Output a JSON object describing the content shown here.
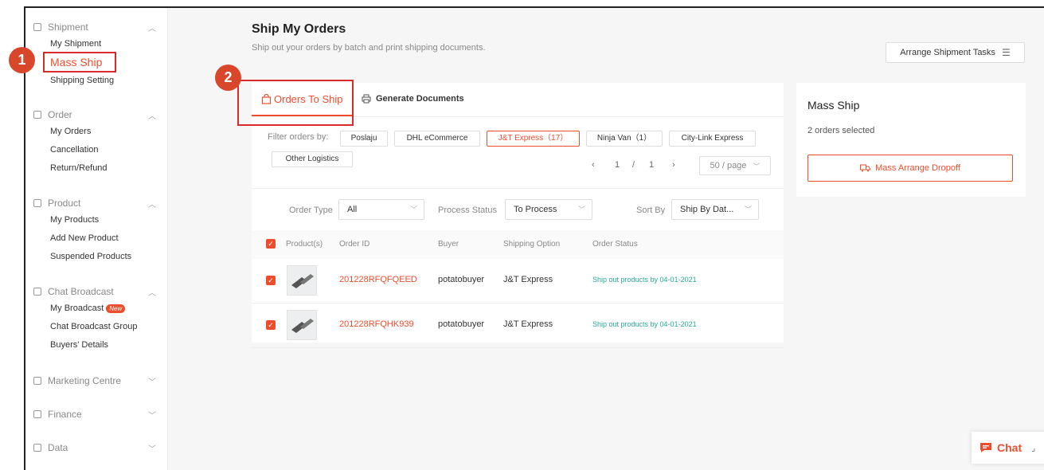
{
  "sidebar": {
    "groups": [
      {
        "title": "Shipment",
        "items": [
          "My Shipment",
          "Mass Ship",
          "Shipping Setting"
        ]
      },
      {
        "title": "Order",
        "items": [
          "My Orders",
          "Cancellation",
          "Return/Refund"
        ]
      },
      {
        "title": "Product",
        "items": [
          "My Products",
          "Add New Product",
          "Suspended Products"
        ]
      },
      {
        "title": "Chat Broadcast",
        "items": [
          "My Broadcast",
          "Chat Broadcast Group",
          "Buyers' Details"
        ],
        "new_badge": "New"
      },
      {
        "title": "Marketing Centre"
      },
      {
        "title": "Finance"
      },
      {
        "title": "Data"
      }
    ]
  },
  "callouts": [
    "1",
    "2"
  ],
  "page": {
    "title": "Ship My Orders",
    "subtitle": "Ship out your orders by batch and print shipping documents.",
    "arrange_button": "Arrange Shipment Tasks",
    "menu_icon": "☰"
  },
  "tabs": [
    "Orders To Ship",
    "Generate Documents"
  ],
  "filters": {
    "label": "Filter orders by:",
    "chips": [
      "Poslaju",
      "DHL eCommerce",
      "J&T Express（17）",
      "Ninja Van（1）",
      "City-Link Express",
      "Other Logistics"
    ],
    "active": "J&T Express（17）"
  },
  "pager": {
    "current": "1",
    "slash": "/",
    "total": "1",
    "per_page": "50 / page",
    "prev": "‹",
    "next": "›"
  },
  "order_filters": {
    "order_type_label": "Order Type",
    "order_type_value": "All",
    "process_status_label": "Process Status",
    "process_status_value": "To Process",
    "sort_by_label": "Sort By",
    "sort_by_value": "Ship By Dat..."
  },
  "table": {
    "columns": [
      "Product(s)",
      "Order ID",
      "Buyer",
      "Shipping Option",
      "Order Status"
    ],
    "rows": [
      {
        "order_id": "201228RFQFQEED",
        "buyer": "potatobuyer",
        "shipping": "J&T Express",
        "status": "Ship out products by 04-01-2021"
      },
      {
        "order_id": "201228RFQHK939",
        "buyer": "potatobuyer",
        "shipping": "J&T Express",
        "status": "Ship out products by 04-01-2021"
      }
    ]
  },
  "side_panel": {
    "title": "Mass Ship",
    "selected": "2 orders selected",
    "button": "Mass Arrange Dropoff"
  },
  "chat": {
    "label": "Chat"
  },
  "colors": {
    "accent": "#ee4d2d",
    "callout": "#d92b2b",
    "status_green": "#26aa99"
  }
}
